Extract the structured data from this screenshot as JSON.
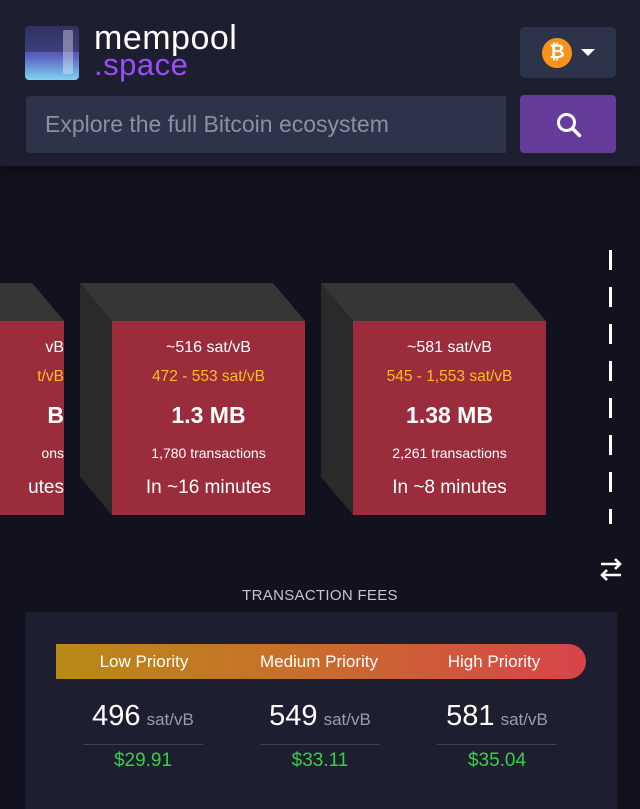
{
  "header": {
    "logo_line1": "mempool",
    "logo_line2": ".space",
    "network_symbol": "₿",
    "search_placeholder": "Explore the full Bitcoin ecosystem"
  },
  "blocks": [
    {
      "fee": "~516 sat/vB",
      "range": "472 - 553 sat/vB",
      "size": "1.3 MB",
      "tx": "1,780 transactions",
      "time": "In ~16 minutes"
    },
    {
      "fee": "~581 sat/vB",
      "range": "545 - 1,553 sat/vB",
      "size": "1.38 MB",
      "tx": "2,261 transactions",
      "time": "In ~8 minutes"
    }
  ],
  "partial_block": {
    "fee": "vB",
    "range": "t/vB",
    "size": "B",
    "tx": "ons",
    "time": "utes"
  },
  "fees": {
    "title": "TRANSACTION FEES",
    "unit": "sat/vB",
    "priorities": [
      {
        "label": "Low Priority",
        "value": "496",
        "usd": "$29.91"
      },
      {
        "label": "Medium Priority",
        "value": "549",
        "usd": "$33.11"
      },
      {
        "label": "High Priority",
        "value": "581",
        "usd": "$35.04"
      }
    ]
  },
  "colors": {
    "background": "#12121f",
    "header": "#1d1f31",
    "accent": "#653b9c",
    "block_face": "#9b2c3b",
    "fee_range": "#fbbf24",
    "usd_green": "#3bcc49"
  }
}
